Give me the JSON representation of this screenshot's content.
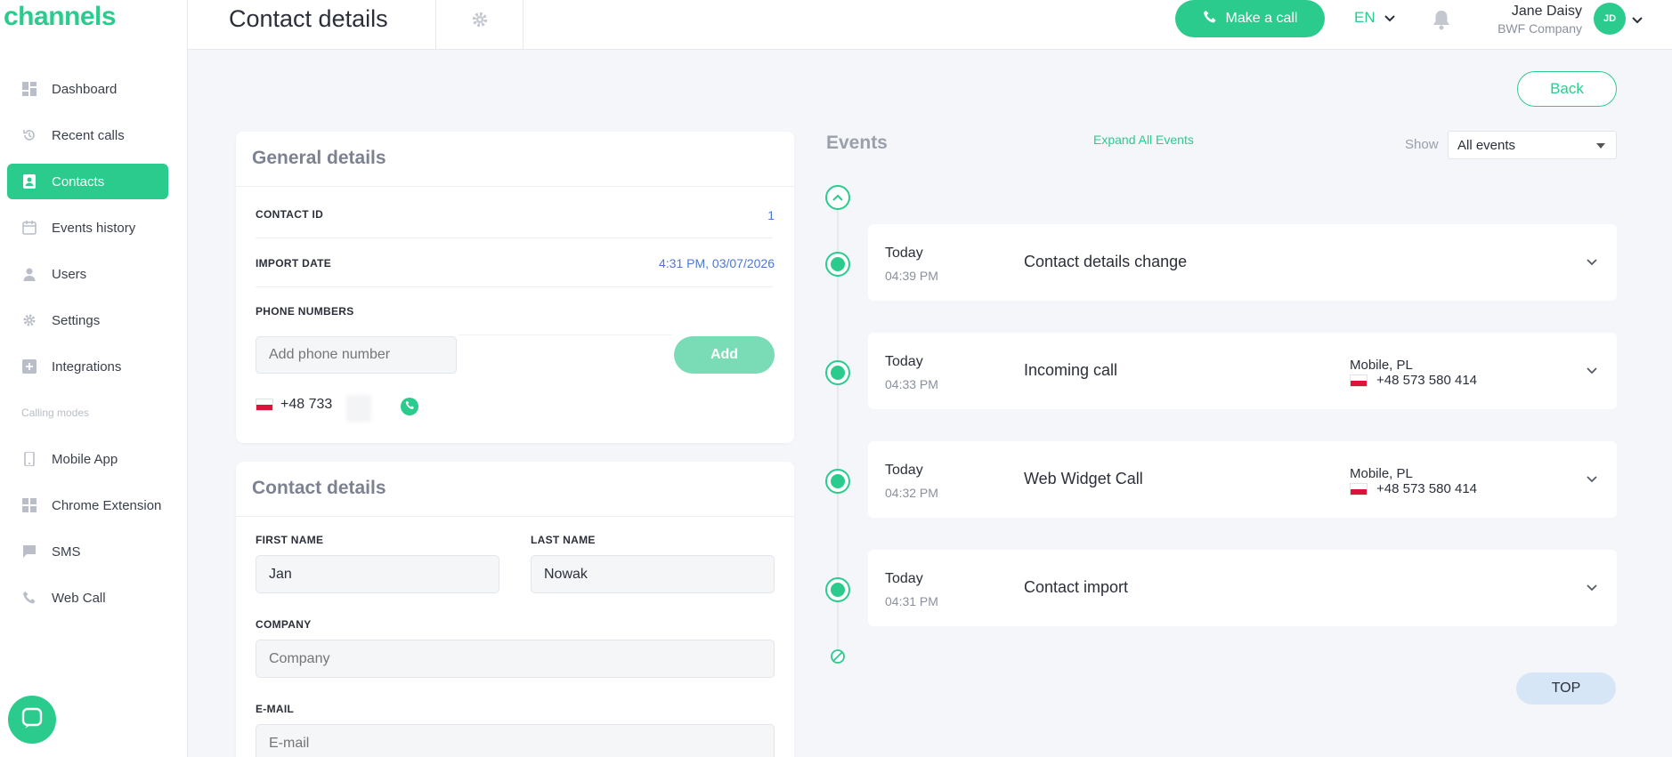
{
  "app": {
    "logo": "channels"
  },
  "sidebar": {
    "items": [
      {
        "label": "Dashboard",
        "icon": "dashboard-icon"
      },
      {
        "label": "Recent calls",
        "icon": "history-icon"
      },
      {
        "label": "Contacts",
        "icon": "contacts-icon",
        "active": true
      },
      {
        "label": "Events history",
        "icon": "calendar-icon"
      },
      {
        "label": "Users",
        "icon": "user-icon"
      },
      {
        "label": "Settings",
        "icon": "gear-icon"
      },
      {
        "label": "Integrations",
        "icon": "plus-box-icon"
      }
    ],
    "section_label": "Calling modes",
    "modes": [
      {
        "label": "Mobile App",
        "icon": "phone-device-icon"
      },
      {
        "label": "Chrome Extension",
        "icon": "extension-icon"
      },
      {
        "label": "SMS",
        "icon": "message-icon"
      },
      {
        "label": "Web Call",
        "icon": "phone-icon"
      }
    ]
  },
  "header": {
    "title": "Contact details",
    "make_call": "Make a call",
    "language": "EN",
    "user_name": "Jane Daisy",
    "user_company": "BWF Company",
    "user_initials": "JD"
  },
  "back_label": "Back",
  "general": {
    "title": "General details",
    "contact_id_label": "CONTACT ID",
    "contact_id": "1",
    "import_date_label": "IMPORT DATE",
    "import_date": "4:31 PM, 03/07/2026",
    "phone_numbers_label": "PHONE NUMBERS",
    "phone_placeholder": "Add phone number",
    "add_label": "Add",
    "phone": "+48 733"
  },
  "contact": {
    "title": "Contact details",
    "first_name_label": "FIRST NAME",
    "first_name": "Jan",
    "last_name_label": "LAST NAME",
    "last_name": "Nowak",
    "company_label": "COMPANY",
    "company_placeholder": "Company",
    "email_label": "E-MAIL",
    "email_placeholder": "E-mail"
  },
  "events": {
    "title": "Events",
    "expand_all": "Expand All Events",
    "show_label": "Show",
    "filter": "All events",
    "items": [
      {
        "day": "Today",
        "time": "04:39 PM",
        "title": "Contact details change",
        "location": "",
        "phone": ""
      },
      {
        "day": "Today",
        "time": "04:33 PM",
        "title": "Incoming call",
        "location": "Mobile, PL",
        "phone": "+48 573 580 414"
      },
      {
        "day": "Today",
        "time": "04:32 PM",
        "title": "Web Widget Call",
        "location": "Mobile, PL",
        "phone": "+48 573 580 414"
      },
      {
        "day": "Today",
        "time": "04:31 PM",
        "title": "Contact import",
        "location": "",
        "phone": ""
      }
    ],
    "top_label": "TOP"
  },
  "colors": {
    "accent": "#2bcb8d",
    "link_blue": "#4a78d4"
  }
}
